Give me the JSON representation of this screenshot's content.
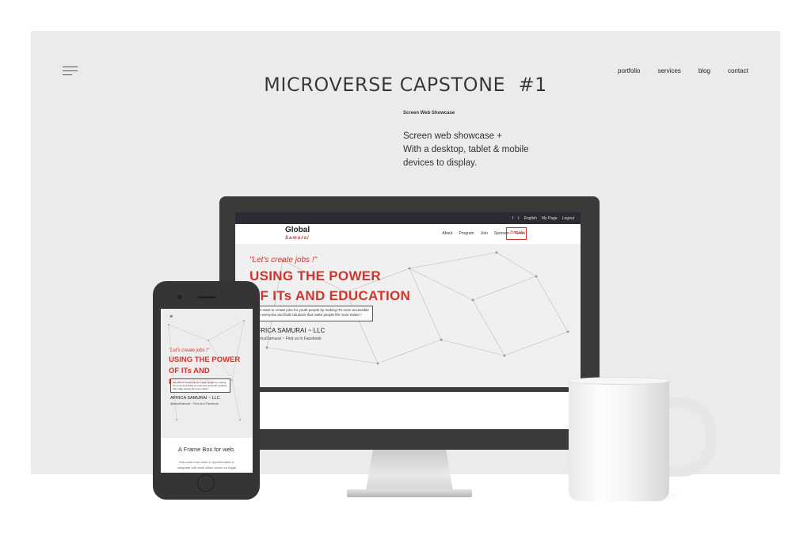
{
  "header": {
    "title": "MICROVERSE CAPSTONE  #1",
    "nav": [
      "portfolio",
      "services",
      "blog",
      "contact"
    ]
  },
  "intro": {
    "eyebrow": "Screen Web Showcase",
    "line1": "Screen web showcase +",
    "line2": "With a desktop, tablet & mobile",
    "line3": "devices to display."
  },
  "desktop_site": {
    "topbar": [
      "f",
      "t",
      "English",
      "My Page",
      "Logout"
    ],
    "logo_main": "Global",
    "logo_sub": "Samurai",
    "nav": [
      "About",
      "Program",
      "Join",
      "Sponsor",
      "News"
    ],
    "join_button": "Join Us",
    "quote": "\"Let's create jobs !\"",
    "headline1": "USING THE POWER",
    "headline2": "OF ITs AND EDUCATION",
    "box_text1": "We want to create jobs for youth people by making ITs more accessible",
    "box_text2": "for everyone and built solutions that make people life more easier !",
    "company": "AFRICA SAMURAI ~ LLC",
    "facebook": "@africaSamurai ~ Find us in Facebook"
  },
  "mobile_site": {
    "menu_icon": "≡",
    "quote": "\"Let's create jobs !\"",
    "headline1": "USING THE POWER",
    "headline2": "OF ITs AND EDUCATION",
    "box_text": "We want to create jobs for youth people by making ITs more accessible for everyone and built solutions that make people life more easier !",
    "company": "AFRICA SAMURAI ~ LLC",
    "facebook": "@africaSamurai ~ Find us in Facebook",
    "frame_title": "A Frame Box for web.",
    "lorem1": "Duis aute irure dolor in reprehenderit in",
    "lorem2": "voluptate velit esse cillum dolore eu fugiat"
  },
  "colors": {
    "accent": "#d0342c",
    "panel": "#ebebeb",
    "device": "#353535"
  }
}
